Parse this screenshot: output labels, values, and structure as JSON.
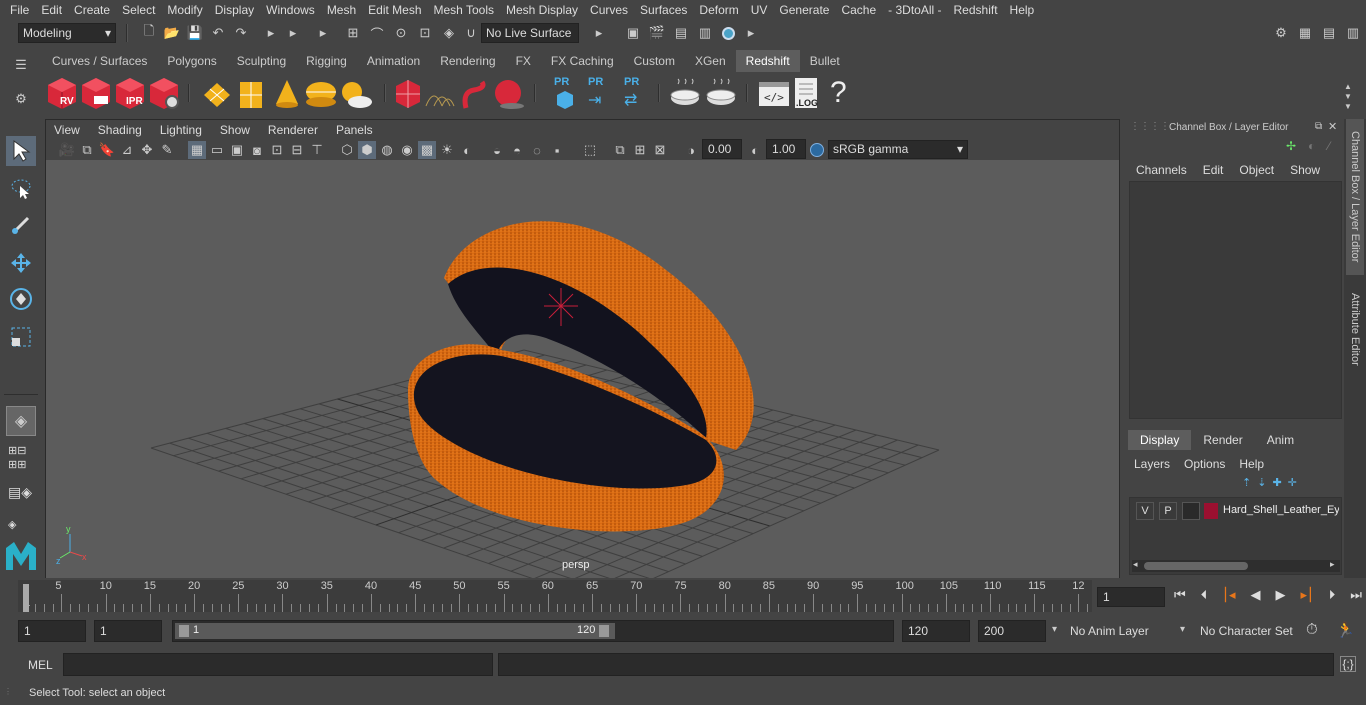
{
  "menubar": [
    "File",
    "Edit",
    "Create",
    "Select",
    "Modify",
    "Display",
    "Windows",
    "Mesh",
    "Edit Mesh",
    "Mesh Tools",
    "Mesh Display",
    "Curves",
    "Surfaces",
    "Deform",
    "UV",
    "Generate",
    "Cache",
    "- 3DtoAll -",
    "Redshift",
    "Help"
  ],
  "status": {
    "mode": "Modeling",
    "live_surface": "No Live Surface"
  },
  "shelf_tabs": [
    {
      "label": "Curves / Surfaces",
      "active": false
    },
    {
      "label": "Polygons",
      "active": false
    },
    {
      "label": "Sculpting",
      "active": false
    },
    {
      "label": "Rigging",
      "active": false
    },
    {
      "label": "Animation",
      "active": false
    },
    {
      "label": "Rendering",
      "active": false
    },
    {
      "label": "FX",
      "active": false
    },
    {
      "label": "FX Caching",
      "active": false
    },
    {
      "label": "Custom",
      "active": false
    },
    {
      "label": "XGen",
      "active": false
    },
    {
      "label": "Redshift",
      "active": true
    },
    {
      "label": "Bullet",
      "active": false
    }
  ],
  "shelf_labels": {
    "rv": "RV",
    "ipr": "IPR",
    "pr": "PR",
    "log": ".LOG",
    "help": "?"
  },
  "viewport": {
    "menu": [
      "View",
      "Shading",
      "Lighting",
      "Show",
      "Renderer",
      "Panels"
    ],
    "exposure": "0.00",
    "gamma": "1.00",
    "colorspace": "sRGB gamma",
    "camera": "persp"
  },
  "channelbox": {
    "title": "Channel Box / Layer Editor",
    "menu": [
      "Channels",
      "Edit",
      "Object",
      "Show"
    ],
    "layer_tabs": [
      {
        "label": "Display",
        "active": true
      },
      {
        "label": "Render",
        "active": false
      },
      {
        "label": "Anim",
        "active": false
      }
    ],
    "layer_menu": [
      "Layers",
      "Options",
      "Help"
    ],
    "layer": {
      "v": "V",
      "p": "P",
      "name": "Hard_Shell_Leather_Ey",
      "color": "#9b1030"
    }
  },
  "sidetabs": {
    "channel": "Channel Box / Layer Editor",
    "attr": "Attribute Editor"
  },
  "timeline": {
    "ticks": [
      "5",
      "10",
      "15",
      "20",
      "25",
      "30",
      "35",
      "40",
      "45",
      "50",
      "55",
      "60",
      "65",
      "70",
      "75",
      "80",
      "85",
      "90",
      "95",
      "100",
      "105",
      "110",
      "115",
      "12"
    ],
    "start_label": "1",
    "current": "1"
  },
  "range": {
    "start": "1",
    "start2": "1",
    "slider_start": "1",
    "slider_end": "120",
    "end": "120",
    "end2": "200",
    "anim_layer": "No Anim Layer",
    "char_set": "No Character Set"
  },
  "mel": {
    "label": "MEL"
  },
  "help": {
    "text": "Select Tool: select an object"
  },
  "colors": {
    "accent": "#e8761a",
    "bg": "#444444",
    "viewport": "#5c5c5c",
    "redshift_red": "#d8283a"
  }
}
